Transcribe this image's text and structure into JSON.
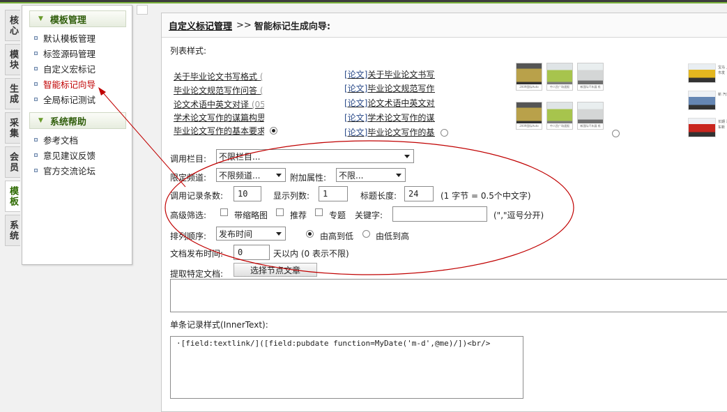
{
  "left_tabs": [
    "核心",
    "模块",
    "生成",
    "采集",
    "会员",
    "模板",
    "系统"
  ],
  "menu": {
    "section1_title": "模板管理",
    "section1_items": [
      "默认模板管理",
      "标签源码管理",
      "自定义宏标记",
      "智能标记向导",
      "全局标记测试"
    ],
    "section2_title": "系统帮助",
    "section2_items": [
      "参考文档",
      "意见建议反馈",
      "官方交流论坛"
    ]
  },
  "breadcrumb": {
    "link": "自定义标记管理",
    "separator": ">>",
    "current": "智能标记生成向导:"
  },
  "list_style_label": "列表样式:",
  "style1_links": [
    "关于毕业论文书写格式",
    "毕业论文规范写作问答",
    "论文术语中英文对译",
    "学术论文写作的谋篇构思",
    "毕业论文写作的基本要求"
  ],
  "style1_dims": [
    "(",
    "(",
    "(05",
    "",
    ""
  ],
  "style2_tag": "[论文]",
  "style2_links": [
    "关于毕业论文书写标",
    "毕业论文规范写作间",
    "论文术语中英文对词",
    "学术论文写作的谋篇",
    "毕业论文写作的基本"
  ],
  "thumb_caps": [
    "2009国际Auto Show",
    "中人民广场速报",
    "新国际汽车展 纸",
    "2009国际Auto Show",
    "中人民广场速报",
    "新国际汽车展 纸"
  ],
  "side_texts": [
    "宝马 上市发",
    "新 汽车",
    "长期 汽车新"
  ],
  "form": {
    "column_label": "调用栏目:",
    "column_value": "不限栏目...",
    "channel_label": "限定频道:",
    "channel_value": "不限频道...",
    "attr_label": "附加属性:",
    "attr_value": "不限...",
    "count_label": "调用记录条数:",
    "count_value": "10",
    "cols_label": "显示列数:",
    "cols_value": "1",
    "titlelen_label": "标题长度:",
    "titlelen_value": "24",
    "titlelen_hint": "(1 字节 = 0.5个中文字)",
    "filter_label": "高级筛选:",
    "filter_thumb": "带缩略图",
    "filter_recommend": "推荐",
    "filter_topic": "专题",
    "keyword_label": "关键字:",
    "keyword_value": "",
    "keyword_hint": "(\",\"逗号分开)",
    "order_label": "排列顺序:",
    "order_value": "发布时间",
    "order_desc": "由高到低",
    "order_asc": "由低到高",
    "pubtime_label": "文档发布时间:",
    "pubtime_value": "0",
    "pubtime_hint": "天以内 (0 表示不限)",
    "extract_label": "提取特定文档:",
    "extract_button": "选择节点文章",
    "innertext_label": "单条记录样式(InnerText):",
    "innertext_value": "·[field:textlink/]([field:pubdate function=MyDate('m-d',@me)/])<br/>"
  },
  "colors": {
    "accent_green": "#7bb33c",
    "annotation_red": "#c00000"
  }
}
